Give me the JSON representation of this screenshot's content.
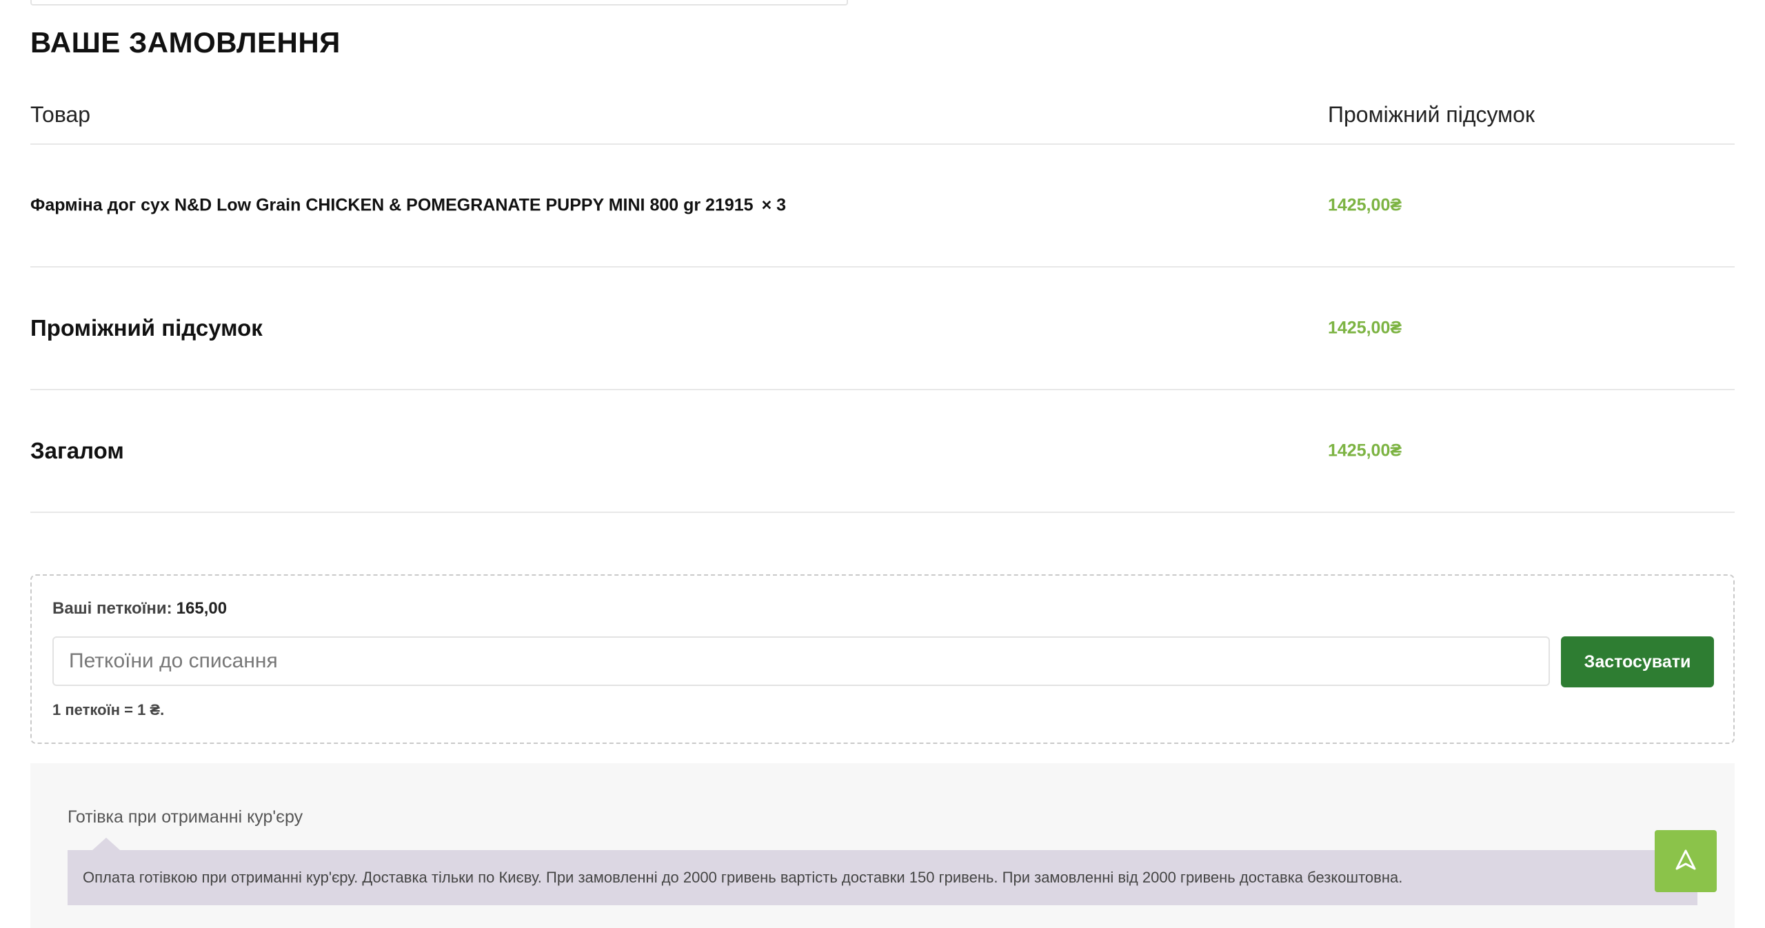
{
  "order": {
    "title": "ВАШЕ ЗАМОВЛЕННЯ",
    "columns": {
      "product": "Товар",
      "subtotal": "Проміжний підсумок"
    },
    "items": [
      {
        "name": "Фарміна дог сух N&D Low Grain CHICKEN & POMEGRANATE PUPPY MINI 800 gr 21915",
        "qty": "× 3",
        "price": "1425,00₴"
      }
    ],
    "subtotal": {
      "label": "Проміжний підсумок",
      "value": "1425,00₴"
    },
    "total": {
      "label": "Загалом",
      "value": "1425,00₴"
    }
  },
  "petcoins": {
    "balance_label": "Ваші петкоїни:",
    "balance_value": "165,00",
    "input_placeholder": "Петкоїни до списання",
    "input_value": "",
    "apply_label": "Застосувати",
    "rate": "1 петкоїн = 1 ₴."
  },
  "payment": {
    "method_label": "Готівка при отриманні кур'єру",
    "description": "Оплата готівкою при отриманні кур'єру. Доставка тільки по Києву. При замовленні до 2000 гривень вартість доставки 150 гривень. При замовленні від 2000 гривень доставка безкоштовна."
  },
  "icons": {
    "scroll_top": "arrow-up-icon"
  },
  "colors": {
    "price": "#7cb342",
    "apply_button": "#2e7d32",
    "scroll_top_button": "#8bc34a",
    "payment_note_bg": "#dcd7e3"
  }
}
